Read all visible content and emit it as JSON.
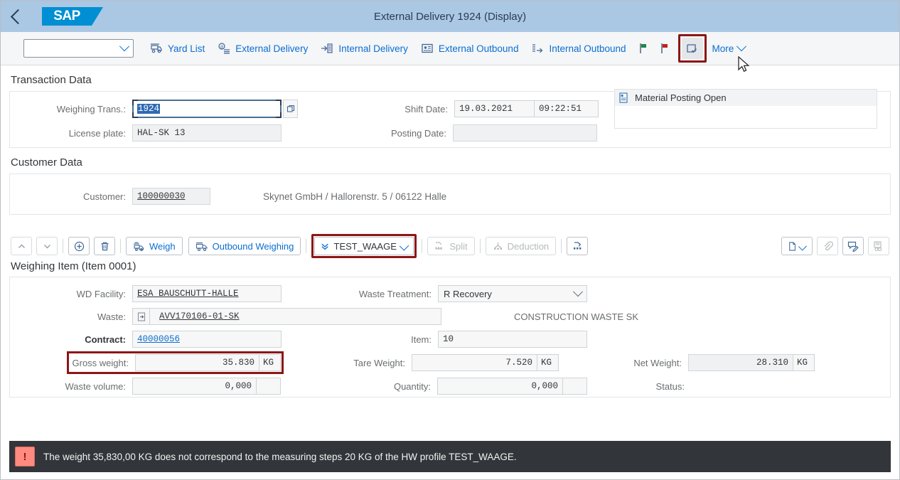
{
  "shell": {
    "back_icon": "chevron-left-icon",
    "logo_text": "SAP",
    "title": "External Delivery 1924 (Display)"
  },
  "toolbar": {
    "select_value": "",
    "actions": [
      {
        "label": "Yard List",
        "icon": "truck-scale-icon"
      },
      {
        "label": "External Delivery",
        "icon": "external-delivery-icon"
      },
      {
        "label": "Internal Delivery",
        "icon": "internal-delivery-icon"
      },
      {
        "label": "External Outbound",
        "icon": "external-outbound-icon"
      },
      {
        "label": "Internal Outbound",
        "icon": "internal-outbound-icon"
      }
    ],
    "flag_green": "green-flag-icon",
    "flag_red": "red-flag-icon",
    "confirm_button_icon": "window-check-icon",
    "more_label": "More"
  },
  "transaction": {
    "section_title": "Transaction Data",
    "weighing_trans_label": "Weighing Trans.:",
    "weighing_trans_value": "1924",
    "license_plate_label": "License plate:",
    "license_plate_value": "HAL-SK  13",
    "shift_date_label": "Shift Date:",
    "shift_date_value": "19.03.2021",
    "shift_time_value": "09:22:51",
    "posting_date_label": "Posting Date:",
    "posting_date_value": "",
    "status_item": "Material Posting Open",
    "status_item_icon": "document-status-icon"
  },
  "customer": {
    "section_title": "Customer Data",
    "customer_label": "Customer:",
    "customer_value": "100000030",
    "customer_desc": "Skynet GmbH / Hallorenstr. 5 / 06122 Halle"
  },
  "item_toolbar": {
    "move_up_icon": "chevron-up-icon",
    "move_down_icon": "chevron-down-icon",
    "add_icon": "plus-circle-icon",
    "delete_icon": "trash-icon",
    "weigh_label": "Weigh",
    "weigh_icon": "weigh-icon",
    "outbound_weighing_label": "Outbound Weighing",
    "outbound_weighing_icon": "truck-icon",
    "scale_profile_value": "TEST_WAAGE",
    "scale_profile_icon": "double-chevron-down-icon",
    "split_label": "Split",
    "split_icon": "split-icon",
    "deduction_label": "Deduction",
    "deduction_icon": "deduction-icon",
    "extra_icon": "transfer-icon",
    "document_icon": "document-icon",
    "attachment_icon": "paperclip-icon",
    "note_icon": "note-edit-icon",
    "report_icon": "report-icon"
  },
  "item": {
    "section_title": "Weighing Item (Item 0001)",
    "wd_facility_label": "WD Facility:",
    "wd_facility_value": "ESA_BAUSCHUTT-HALLE",
    "waste_label": "Waste:",
    "waste_value": "AVV170106-01-SK",
    "waste_icon": "navigate-icon",
    "contract_label": "Contract:",
    "contract_value": "40000056",
    "gross_weight_label": "Gross weight:",
    "gross_weight_value": "35.830",
    "gross_weight_unit": "KG",
    "waste_volume_label": "Waste volume:",
    "waste_volume_value": "0,000",
    "waste_volume_unit": "",
    "waste_treatment_label": "Waste Treatment:",
    "waste_treatment_value": "R Recovery",
    "waste_desc": "CONSTRUCTION WASTE SK",
    "item_label": "Item:",
    "item_value": "10",
    "tare_weight_label": "Tare Weight:",
    "tare_weight_value": "7.520",
    "tare_weight_unit": "KG",
    "quantity_label": "Quantity:",
    "quantity_value": "0,000",
    "quantity_unit": "",
    "net_weight_label": "Net Weight:",
    "net_weight_value": "28.310",
    "net_weight_unit": "KG",
    "status_label": "Status:"
  },
  "message": {
    "icon": "error-icon",
    "text": "The weight 35,830,00 KG does not correspond to the measuring steps 20 KG of the HW profile TEST_WAAGE."
  },
  "colors": {
    "shell_bg": "#aac7e4",
    "accent": "#0a6ed1",
    "highlight": "#8c1616",
    "message_bg": "#32363a"
  }
}
